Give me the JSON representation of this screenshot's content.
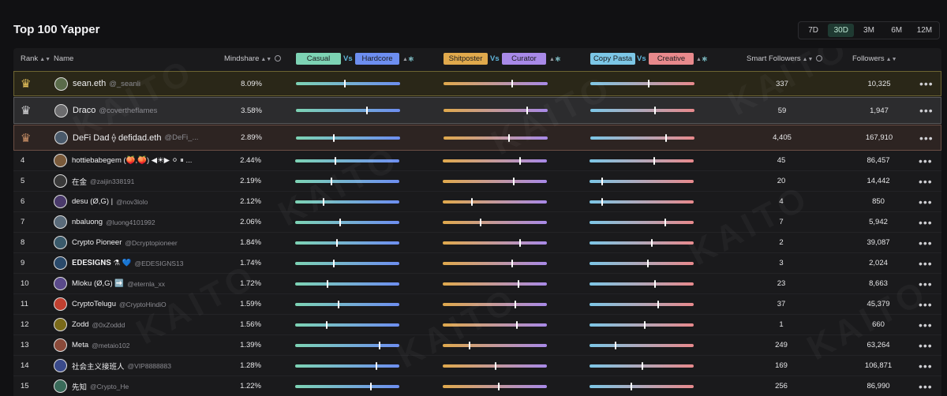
{
  "page": {
    "title": "Top 100 Yapper"
  },
  "periods": [
    {
      "label": "7D",
      "active": false
    },
    {
      "label": "30D",
      "active": true
    },
    {
      "label": "3M",
      "active": false
    },
    {
      "label": "6M",
      "active": false
    },
    {
      "label": "12M",
      "active": false
    }
  ],
  "columns": {
    "rank": "Rank",
    "name": "Name",
    "mindshare": "Mindshare",
    "smart_followers": "Smart Followers",
    "followers": "Followers",
    "vs": "Vs",
    "pair1": {
      "left": "Casual",
      "right": "Hardcore"
    },
    "pair2": {
      "left": "Shitposter",
      "right": "Curator"
    },
    "pair3": {
      "left": "Copy Pasta",
      "right": "Creative"
    }
  },
  "colors": {
    "casual": "#7dd3b4",
    "hardcore": "#6d8ef0",
    "shitposter": "#e0a94c",
    "curator": "#a889e8",
    "copypasta": "#7cc6e6",
    "creative": "#e8898c"
  },
  "watermark": "KAITO",
  "more_icon": "more-horizontal-icon",
  "rows": [
    {
      "rank": "1",
      "medal": "gold",
      "crown": "crown-icon",
      "name": "sean.eth",
      "handle": "@_seanli",
      "mindshare": "8.09%",
      "p1": 0.47,
      "p2": 0.66,
      "p3": 0.56,
      "smart": "337",
      "followers": "10,325"
    },
    {
      "rank": "2",
      "medal": "silver",
      "crown": "crown-icon",
      "name": "Draco",
      "handle": "@covertheflames",
      "mindshare": "3.58%",
      "p1": 0.68,
      "p2": 0.8,
      "p3": 0.62,
      "smart": "59",
      "followers": "1,947"
    },
    {
      "rank": "3",
      "medal": "bronze",
      "crown": "crown-icon",
      "name": "DeFi Dad ⟠ defidad.eth",
      "handle": "@DeFi_...",
      "mindshare": "2.89%",
      "p1": 0.36,
      "p2": 0.63,
      "p3": 0.73,
      "smart": "4,405",
      "followers": "167,910"
    },
    {
      "rank": "4",
      "name": "hottiebabegem (🍑,🍑) ◀☀▶ ⚪ ⏸ ...",
      "handle": "",
      "mindshare": "2.44%",
      "p1": 0.39,
      "p2": 0.74,
      "p3": 0.62,
      "smart": "45",
      "followers": "86,457"
    },
    {
      "rank": "5",
      "name": "在金",
      "handle": "@zaijin338191",
      "mindshare": "2.19%",
      "p1": 0.35,
      "p2": 0.68,
      "p3": 0.12,
      "smart": "20",
      "followers": "14,442"
    },
    {
      "rank": "6",
      "name": "desu (Ø,G) |",
      "handle": "@nov3lolo",
      "mindshare": "2.12%",
      "p1": 0.27,
      "p2": 0.28,
      "p3": 0.12,
      "smart": "4",
      "followers": "850"
    },
    {
      "rank": "7",
      "name": "nbaluong",
      "handle": "@luong4101992",
      "mindshare": "2.06%",
      "p1": 0.43,
      "p2": 0.36,
      "p3": 0.73,
      "smart": "7",
      "followers": "5,942"
    },
    {
      "rank": "8",
      "name": "Crypto Pioneer",
      "handle": "@Dcryptopioneer",
      "mindshare": "1.84%",
      "p1": 0.4,
      "p2": 0.74,
      "p3": 0.6,
      "smart": "2",
      "followers": "39,087"
    },
    {
      "rank": "9",
      "name": "𝐄𝐃𝐄𝐒𝐈𝐆𝐍𝐒 ⚗ 💙",
      "handle": "@EDESIGNS13",
      "mindshare": "1.74%",
      "p1": 0.37,
      "p2": 0.67,
      "p3": 0.56,
      "smart": "3",
      "followers": "2,024"
    },
    {
      "rank": "10",
      "name": "Mloku (Ø,G) ➡️",
      "handle": "@eternla_xx",
      "mindshare": "1.72%",
      "p1": 0.31,
      "p2": 0.73,
      "p3": 0.63,
      "smart": "23",
      "followers": "8,663"
    },
    {
      "rank": "11",
      "name": "CryptoTelugu",
      "handle": "@CryptoHindiO",
      "mindshare": "1.59%",
      "p1": 0.42,
      "p2": 0.7,
      "p3": 0.66,
      "smart": "37",
      "followers": "45,379"
    },
    {
      "rank": "12",
      "name": "Zodd",
      "handle": "@0xZoddd",
      "mindshare": "1.56%",
      "p1": 0.3,
      "p2": 0.71,
      "p3": 0.53,
      "smart": "1",
      "followers": "660"
    },
    {
      "rank": "13",
      "name": "Meta",
      "handle": "@metaio102",
      "mindshare": "1.39%",
      "p1": 0.81,
      "p2": 0.26,
      "p3": 0.25,
      "smart": "249",
      "followers": "63,264"
    },
    {
      "rank": "14",
      "name": "社会主义接班人",
      "handle": "@VIP8888883",
      "mindshare": "1.28%",
      "p1": 0.78,
      "p2": 0.51,
      "p3": 0.51,
      "smart": "169",
      "followers": "106,871"
    },
    {
      "rank": "15",
      "name": "先知",
      "handle": "@Crypto_He",
      "mindshare": "1.22%",
      "p1": 0.73,
      "p2": 0.54,
      "p3": 0.4,
      "smart": "256",
      "followers": "86,990"
    }
  ]
}
